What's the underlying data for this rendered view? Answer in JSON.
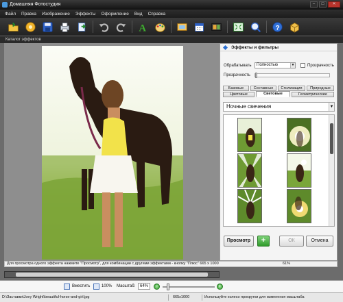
{
  "window": {
    "title": "Домашняя Фотостудия"
  },
  "menu": [
    "Файл",
    "Правка",
    "Изображение",
    "Эффекты",
    "Оформление",
    "Вид",
    "Справка"
  ],
  "toolbar": {
    "icons": [
      "open-folder-icon",
      "open-gallery-icon",
      "save-icon",
      "print-icon",
      "export-icon",
      "undo-icon",
      "redo-icon",
      "text-icon",
      "palette-icon",
      "frame-icon",
      "calendar-icon",
      "collage-icon",
      "fit-screen-icon",
      "zoom-100-icon",
      "help-icon",
      "package-icon"
    ]
  },
  "panel_header": "Каталог эффектов",
  "effects_panel": {
    "title": "Эффекты и фильтры",
    "process_label": "Обрабатывать",
    "process_value": "Полностью",
    "transparency_check_label": "Прозрачность",
    "transparency_label": "Прозрачность",
    "tabs_row1": [
      "Базовые",
      "Составные",
      "Стилизация",
      "Природные"
    ],
    "tabs_row2": [
      "Цветовые",
      "Световые",
      "Геометрические"
    ],
    "active_tab": "Световые",
    "effect_dropdown": "Ночные свечения",
    "buttons": {
      "preview": "Просмотр",
      "plus": "+",
      "ok": "ОК",
      "cancel": "Отмена"
    }
  },
  "status": {
    "hint": "Для просмотра одного эффекта нажмите \"Просмотр\", для комбинации с другими эффектами - кнопку \"Плюс\" 665 x 1000",
    "percent": "61%"
  },
  "zoom": {
    "fit_label": "Вместить",
    "actual_label": "100%",
    "scale_label": "Масштаб:",
    "scale_value": "64%",
    "minus": "−",
    "plus": "+",
    "level": 0.64
  },
  "bottom": {
    "path": "D:\\Заставки\\Joey Wright\\beautiful-horse-and-girl.jpg",
    "dimensions": "665x1000",
    "hint": "Используйте колесо прокрутки для изменения масштаба"
  },
  "colors": {
    "accent": "#2a6fd1",
    "green": "#2f9a2a",
    "dark": "#1c1c1c"
  }
}
